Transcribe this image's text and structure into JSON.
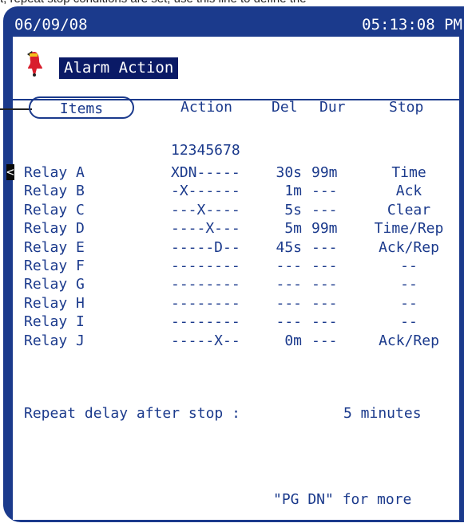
{
  "top_caption": "t, repeat stop conditions are set, use this line to define the",
  "status_bar": {
    "date": "06/09/08",
    "time": "05:13:08 PM"
  },
  "page": {
    "title": "Alarm Action"
  },
  "columns": {
    "items": "Items",
    "action": "Action",
    "del": "Del",
    "dur": "Dur",
    "stop": "Stop"
  },
  "relay_index": "12345678",
  "cursor": "<",
  "relays": [
    {
      "name": "Relay A",
      "action": "XDN-----",
      "del": "30s",
      "dur": "99m",
      "stop": "Time"
    },
    {
      "name": "Relay B",
      "action": "-X------",
      "del": "1m",
      "dur": "---",
      "stop": "Ack"
    },
    {
      "name": "Relay C",
      "action": "---X----",
      "del": "5s",
      "dur": "---",
      "stop": "Clear"
    },
    {
      "name": "Relay D",
      "action": "----X---",
      "del": "5m",
      "dur": "99m",
      "stop": "Time/Rep"
    },
    {
      "name": "Relay E",
      "action": "-----D--",
      "del": "45s",
      "dur": "---",
      "stop": "Ack/Rep"
    },
    {
      "name": "Relay F",
      "action": "--------",
      "del": "---",
      "dur": "---",
      "stop": "--"
    },
    {
      "name": "Relay G",
      "action": "--------",
      "del": "---",
      "dur": "---",
      "stop": "--"
    },
    {
      "name": "Relay H",
      "action": "--------",
      "del": "---",
      "dur": "---",
      "stop": "--"
    },
    {
      "name": "Relay I",
      "action": "--------",
      "del": "---",
      "dur": "---",
      "stop": "--"
    },
    {
      "name": "Relay J",
      "action": "-----X--",
      "del": "0m",
      "dur": "---",
      "stop": "Ack/Rep"
    }
  ],
  "repeat_delay": {
    "label": "Repeat delay after stop :",
    "value": "5 minutes"
  },
  "footer": {
    "hint": "\"PG DN\" for more"
  },
  "colors": {
    "frame": "#1b3a8c",
    "text": "#1b3a8c",
    "title_bg": "#0a1a66",
    "icon": "#d81e2c"
  }
}
